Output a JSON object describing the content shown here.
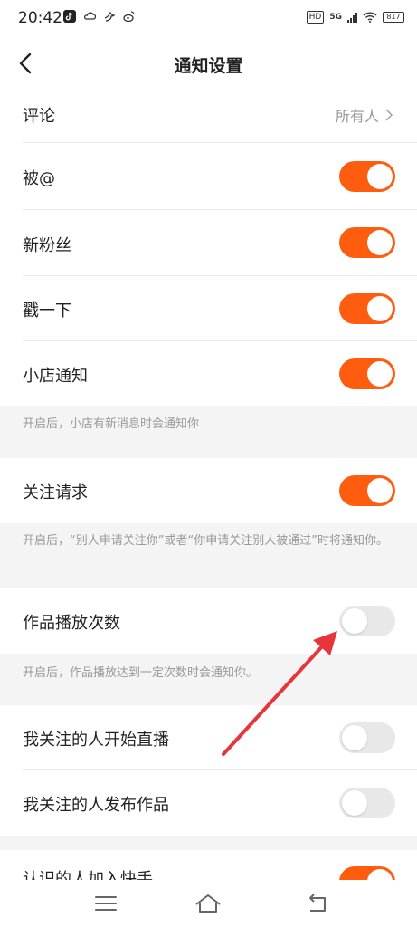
{
  "status_bar": {
    "time": "20:42",
    "left_icons": [
      "tiktok-icon",
      "cloud-icon",
      "bird-icon",
      "weibo-icon"
    ],
    "hd": "HD",
    "network": "5G",
    "battery": "817"
  },
  "header": {
    "title": "通知设置"
  },
  "rows": {
    "comment": {
      "label": "评论",
      "value": "所有人"
    },
    "at": {
      "label": "被@",
      "on": true
    },
    "new_fans": {
      "label": "新粉丝",
      "on": true
    },
    "poke": {
      "label": "戳一下",
      "on": true
    },
    "shop": {
      "label": "小店通知",
      "on": true,
      "note": "开启后，小店有新消息时会通知你"
    },
    "follow_request": {
      "label": "关注请求",
      "on": true,
      "note": "开启后，“别人申请关注你”或者“你申请关注别人被通过”时将通知你。"
    },
    "play_count": {
      "label": "作品播放次数",
      "on": false,
      "note": "开启后，作品播放达到一定次数时会通知你。"
    },
    "live_start": {
      "label": "我关注的人开始直播",
      "on": false
    },
    "post_work": {
      "label": "我关注的人发布作品",
      "on": false
    },
    "partial": {
      "label": "认识的人加入快手",
      "on": true
    }
  },
  "colors": {
    "accent": "#fe5d0f",
    "arrow": "#e8343b"
  }
}
